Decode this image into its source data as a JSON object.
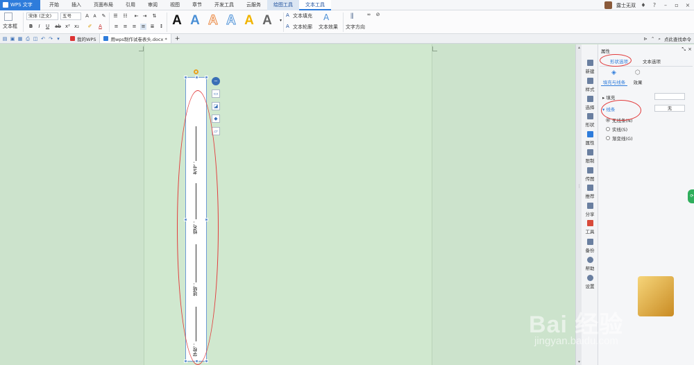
{
  "titlebar": {
    "app_label": "WPS 文字",
    "menu": [
      "开始",
      "插入",
      "页面布局",
      "引用",
      "审阅",
      "视图",
      "章节",
      "开发工具",
      "云服务",
      "绘图工具",
      "文本工具"
    ],
    "user_name": "露士无双"
  },
  "ribbon": {
    "textbox_label": "文本框",
    "font_name": "宋体 (正文)",
    "font_size": "五号",
    "text_fill": "文本填充",
    "text_outline": "文本轮廓",
    "text_effect": "文本效果",
    "text_direction": "文字方向",
    "style_letter": "A"
  },
  "tabstrip": {
    "tabs": [
      "我的WPS",
      "用wps制作试卷表头.docx *"
    ],
    "add": "+",
    "search": "点此查找命令"
  },
  "document": {
    "fields": [
      "考号：",
      "姓名：",
      "班级：",
      "学校："
    ]
  },
  "sidebar": {
    "items": [
      "新建",
      "样式",
      "选择",
      "形状",
      "属性",
      "限制",
      "传图",
      "推荐",
      "分享",
      "工具",
      "备份",
      "帮助",
      "设置"
    ]
  },
  "properties": {
    "title": "属性",
    "tabs": [
      "形状选项",
      "文本选项"
    ],
    "subtabs": [
      "填充与线条",
      "效果"
    ],
    "fill_label": "填充",
    "line_label": "线条",
    "line_value": "无",
    "options": [
      "无线条(N)",
      "实线(S)",
      "渐变线(G)"
    ]
  },
  "watermark": {
    "brand": "Bai 经验",
    "url": "jingyan.baidu.com"
  },
  "colors": {
    "accent": "#2e7cdb",
    "annotation": "#e23a3a",
    "doc_bg": "#cce3cc"
  }
}
